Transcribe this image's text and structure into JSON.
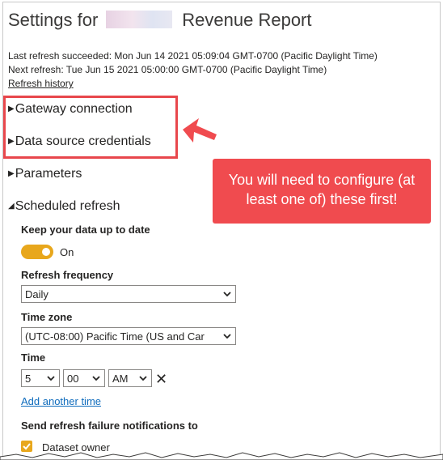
{
  "title": {
    "prefix": "Settings for",
    "report_name": "Revenue Report"
  },
  "refresh_info": {
    "last": "Last refresh succeeded: Mon Jun 14 2021 05:09:04 GMT-0700 (Pacific Daylight Time)",
    "next": "Next refresh: Tue Jun 15 2021 05:00:00 GMT-0700 (Pacific Daylight Time)",
    "history_link": "Refresh history"
  },
  "sections": {
    "gateway": "Gateway connection",
    "credentials": "Data source credentials",
    "parameters": "Parameters",
    "scheduled": "Scheduled refresh"
  },
  "callout": {
    "text": "You will need to configure (at least one of) these first!"
  },
  "scheduled_refresh": {
    "keep_label": "Keep your data up to date",
    "toggle_state": "On",
    "frequency_label": "Refresh frequency",
    "frequency_value": "Daily",
    "timezone_label": "Time zone",
    "timezone_value": "(UTC-08:00) Pacific Time (US and Car",
    "time_label": "Time",
    "hour": "5",
    "minute": "00",
    "ampm": "AM",
    "add_time_link": "Add another time",
    "notify_label": "Send refresh failure notifications to",
    "dataset_owner": "Dataset owner"
  },
  "colors": {
    "accent_toggle": "#e8a71c",
    "callout_red": "#f04b4f",
    "link_blue": "#0f6cbd"
  }
}
